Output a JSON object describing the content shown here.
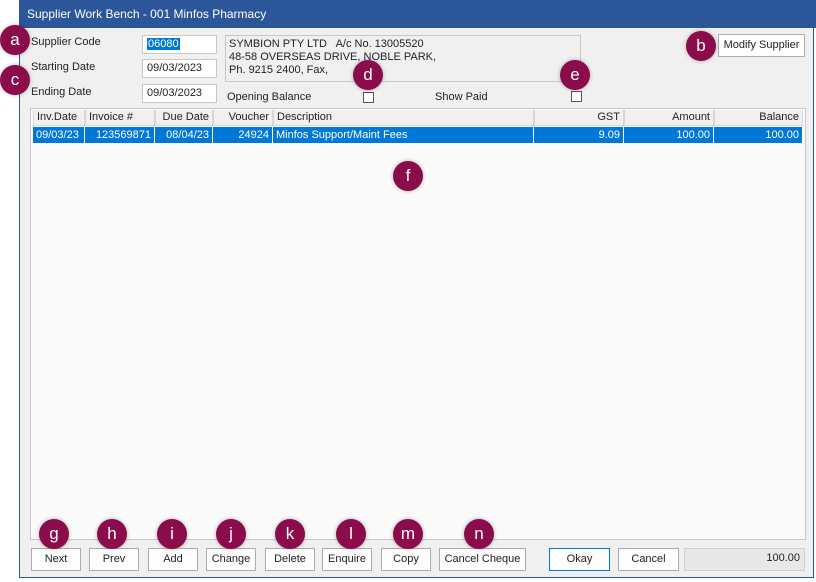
{
  "window": {
    "title": "Supplier Work Bench - 001 Minfos Pharmacy"
  },
  "form": {
    "supplier_code_label": "Supplier Code",
    "supplier_code": "06080",
    "starting_date_label": "Starting Date",
    "starting_date": "09/03/2023",
    "ending_date_label": "Ending Date",
    "ending_date": "09/03/2023",
    "address": [
      "SYMBION PTY LTD   A/c No. 13005520",
      "48-58 OVERSEAS DRIVE, NOBLE PARK,",
      "Ph. 9215 2400, Fax,"
    ],
    "opening_balance_label": "Opening Balance",
    "opening_balance_checked": false,
    "show_paid_label": "Show Paid",
    "show_paid_checked": false,
    "modify_supplier": "Modify Supplier"
  },
  "grid": {
    "columns": [
      "Inv.Date",
      "Invoice #",
      "Due Date",
      "Voucher",
      "Description",
      "GST",
      "Amount",
      "Balance"
    ],
    "rows": [
      [
        "09/03/23",
        "123569871",
        "08/04/23",
        "24924",
        "Minfos Support/Maint Fees",
        "9.09",
        "100.00",
        "100.00"
      ]
    ]
  },
  "buttons": {
    "next": "Next",
    "prev": "Prev",
    "add": "Add",
    "change": "Change",
    "delete": "Delete",
    "enquire": "Enquire",
    "copy": "Copy",
    "cancel_cheque": "Cancel Cheque",
    "okay": "Okay",
    "cancel": "Cancel"
  },
  "total": "100.00",
  "badges": {
    "a": "a",
    "b": "b",
    "c": "c",
    "d": "d",
    "e": "e",
    "f": "f",
    "g": "g",
    "h": "h",
    "i": "i",
    "j": "j",
    "k": "k",
    "l": "l",
    "m": "m",
    "n": "n"
  },
  "colors": {
    "title_bar": "#2b579a",
    "selection": "#0078d7",
    "badge": "#8b0c4b"
  }
}
